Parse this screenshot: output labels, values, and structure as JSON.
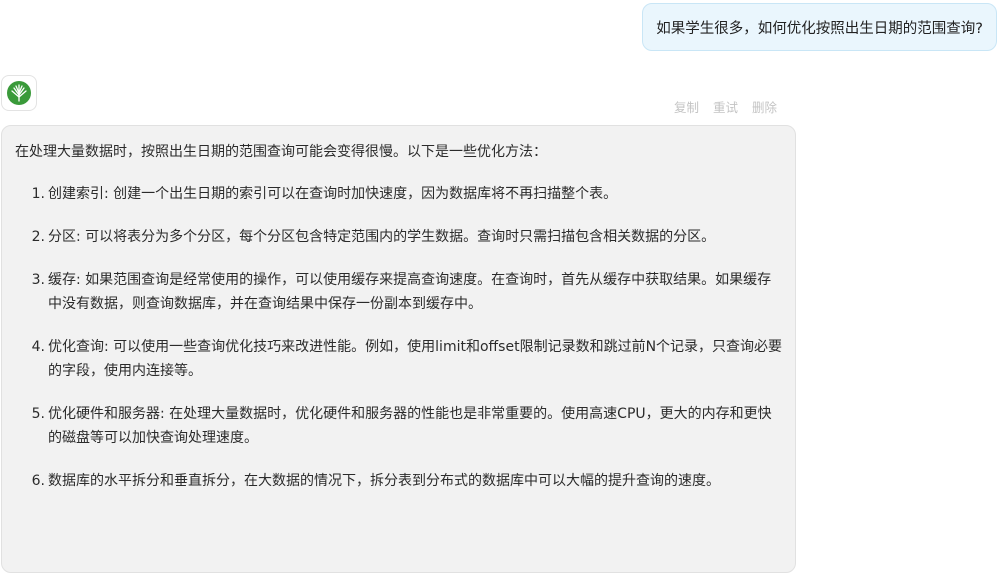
{
  "user_message": "如果学生很多，如何优化按照出生日期的范围查询?",
  "assistant": {
    "avatar_icon": "tree-logo-icon",
    "actions": [
      "复制",
      "重试",
      "删除"
    ],
    "intro": "在处理大量数据时，按照出生日期的范围查询可能会变得很慢。以下是一些优化方法：",
    "items": [
      {
        "num": "1.",
        "text": "创建索引: 创建一个出生日期的索引可以在查询时加快速度，因为数据库将不再扫描整个表。"
      },
      {
        "num": "2.",
        "text": "分区: 可以将表分为多个分区，每个分区包含特定范围内的学生数据。查询时只需扫描包含相关数据的分区。"
      },
      {
        "num": "3.",
        "text": "缓存: 如果范围查询是经常使用的操作，可以使用缓存来提高查询速度。在查询时，首先从缓存中获取结果。如果缓存中没有数据，则查询数据库，并在查询结果中保存一份副本到缓存中。"
      },
      {
        "num": "4.",
        "text": "优化查询: 可以使用一些查询优化技巧来改进性能。例如，使用limit和offset限制记录数和跳过前N个记录，只查询必要的字段，使用内连接等。"
      },
      {
        "num": "5.",
        "text": "优化硬件和服务器: 在处理大量数据时，优化硬件和服务器的性能也是非常重要的。使用高速CPU，更大的内存和更快的磁盘等可以加快查询处理速度。"
      },
      {
        "num": "6.",
        "text": "数据库的水平拆分和垂直拆分，在大数据的情况下，拆分表到分布式的数据库中可以大幅的提升查询的速度。"
      }
    ]
  },
  "colors": {
    "user_bubble_bg": "#eaf6fd",
    "assistant_bubble_bg": "#f2f2f2",
    "logo_green": "#3a9a3a",
    "action_text": "#c4c4c4"
  }
}
